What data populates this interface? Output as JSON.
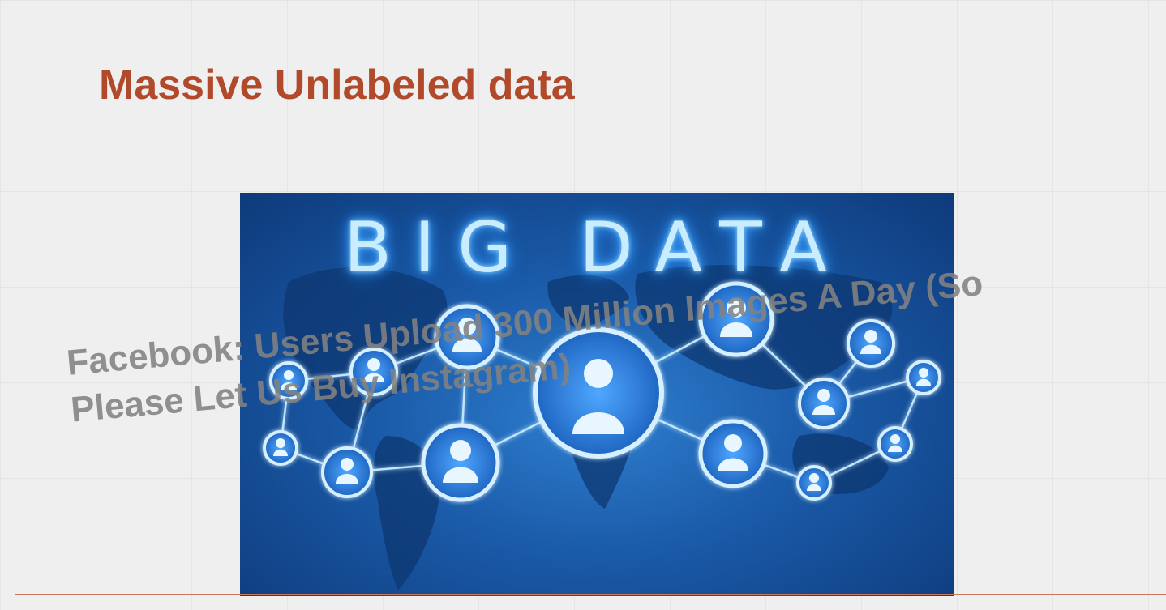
{
  "slide": {
    "title": "Massive Unlabeled data",
    "caption_lines": [
      "Facebook: Users Upload 300 Million Images A Day (So",
      "Please Let Us Buy Instagram)"
    ]
  },
  "picture": {
    "heading": "BIG DATA",
    "subject": "world map with connected user network icons",
    "icon": "user-node-icon"
  },
  "colors": {
    "background": "#efefef",
    "title": "#b04a2a",
    "rule": "#c97a5d",
    "caption": "#828282",
    "picture_blue": "#1a5aa8",
    "glow": "#8fd3ff"
  }
}
